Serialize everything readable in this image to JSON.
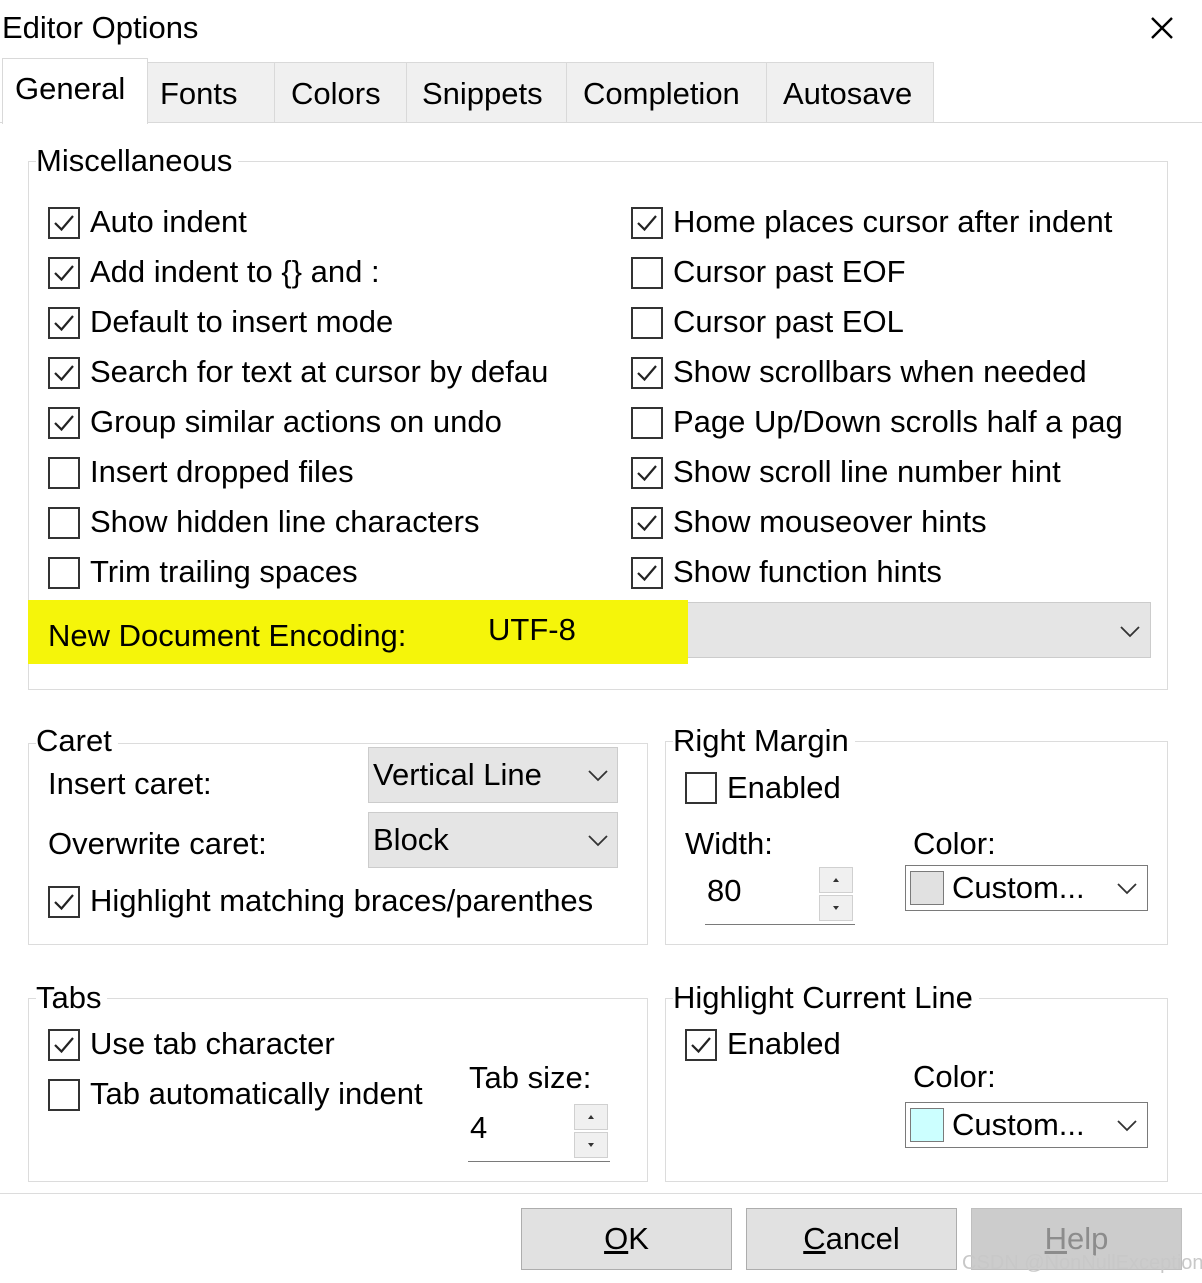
{
  "window": {
    "title": "Editor Options",
    "close_icon": "close-icon"
  },
  "tabs": [
    {
      "label": "General",
      "active": true
    },
    {
      "label": "Fonts",
      "active": false
    },
    {
      "label": "Colors",
      "active": false
    },
    {
      "label": "Snippets",
      "active": false
    },
    {
      "label": "Completion",
      "active": false
    },
    {
      "label": "Autosave",
      "active": false
    }
  ],
  "misc": {
    "title": "Miscellaneous",
    "left": [
      {
        "label": "Auto indent",
        "checked": true
      },
      {
        "label": "Add indent to {} and :",
        "checked": true
      },
      {
        "label": "Default to insert mode",
        "checked": true
      },
      {
        "label": "Search for text at cursor by defau",
        "checked": true
      },
      {
        "label": "Group similar actions on undo",
        "checked": true
      },
      {
        "label": "Insert dropped files",
        "checked": false
      },
      {
        "label": "Show hidden line characters",
        "checked": false
      },
      {
        "label": "Trim trailing spaces",
        "checked": false
      }
    ],
    "right": [
      {
        "label": "Home places cursor after indent",
        "checked": true
      },
      {
        "label": "Cursor past EOF",
        "checked": false
      },
      {
        "label": "Cursor past EOL",
        "checked": false
      },
      {
        "label": "Show scrollbars when needed",
        "checked": true
      },
      {
        "label": "Page Up/Down scrolls half a pag",
        "checked": false
      },
      {
        "label": "Show scroll line number hint",
        "checked": true
      },
      {
        "label": "Show mouseover hints",
        "checked": true
      },
      {
        "label": "Show function hints",
        "checked": true
      }
    ],
    "encoding_label": "New Document Encoding:",
    "encoding_value": "UTF-8",
    "highlight_color": "#f5f50a"
  },
  "caret": {
    "title": "Caret",
    "insert_label": "Insert caret:",
    "insert_value": "Vertical Line",
    "overwrite_label": "Overwrite caret:",
    "overwrite_value": "Block",
    "braces_label": "Highlight matching braces/parenthes",
    "braces_checked": true
  },
  "right_margin": {
    "title": "Right Margin",
    "enabled_label": "Enabled",
    "enabled_checked": false,
    "width_label": "Width:",
    "width_value": "80",
    "color_label": "Color:",
    "color_value": "Custom...",
    "swatch_color": "#e1e1e1"
  },
  "tabs_group": {
    "title": "Tabs",
    "use_tab_label": "Use tab character",
    "use_tab_checked": true,
    "auto_indent_label": "Tab automatically indent",
    "auto_indent_checked": false,
    "tab_size_label": "Tab size:",
    "tab_size_value": "4"
  },
  "current_line": {
    "title": "Highlight Current Line",
    "enabled_label": "Enabled",
    "enabled_checked": true,
    "color_label": "Color:",
    "color_value": "Custom...",
    "swatch_color": "#ccffff"
  },
  "buttons": {
    "ok_accel": "O",
    "ok_rest": "K",
    "cancel_accel": "C",
    "cancel_rest": "ancel",
    "help_accel": "H",
    "help_rest": "elp"
  },
  "watermark": "CSDN @NonNullException"
}
